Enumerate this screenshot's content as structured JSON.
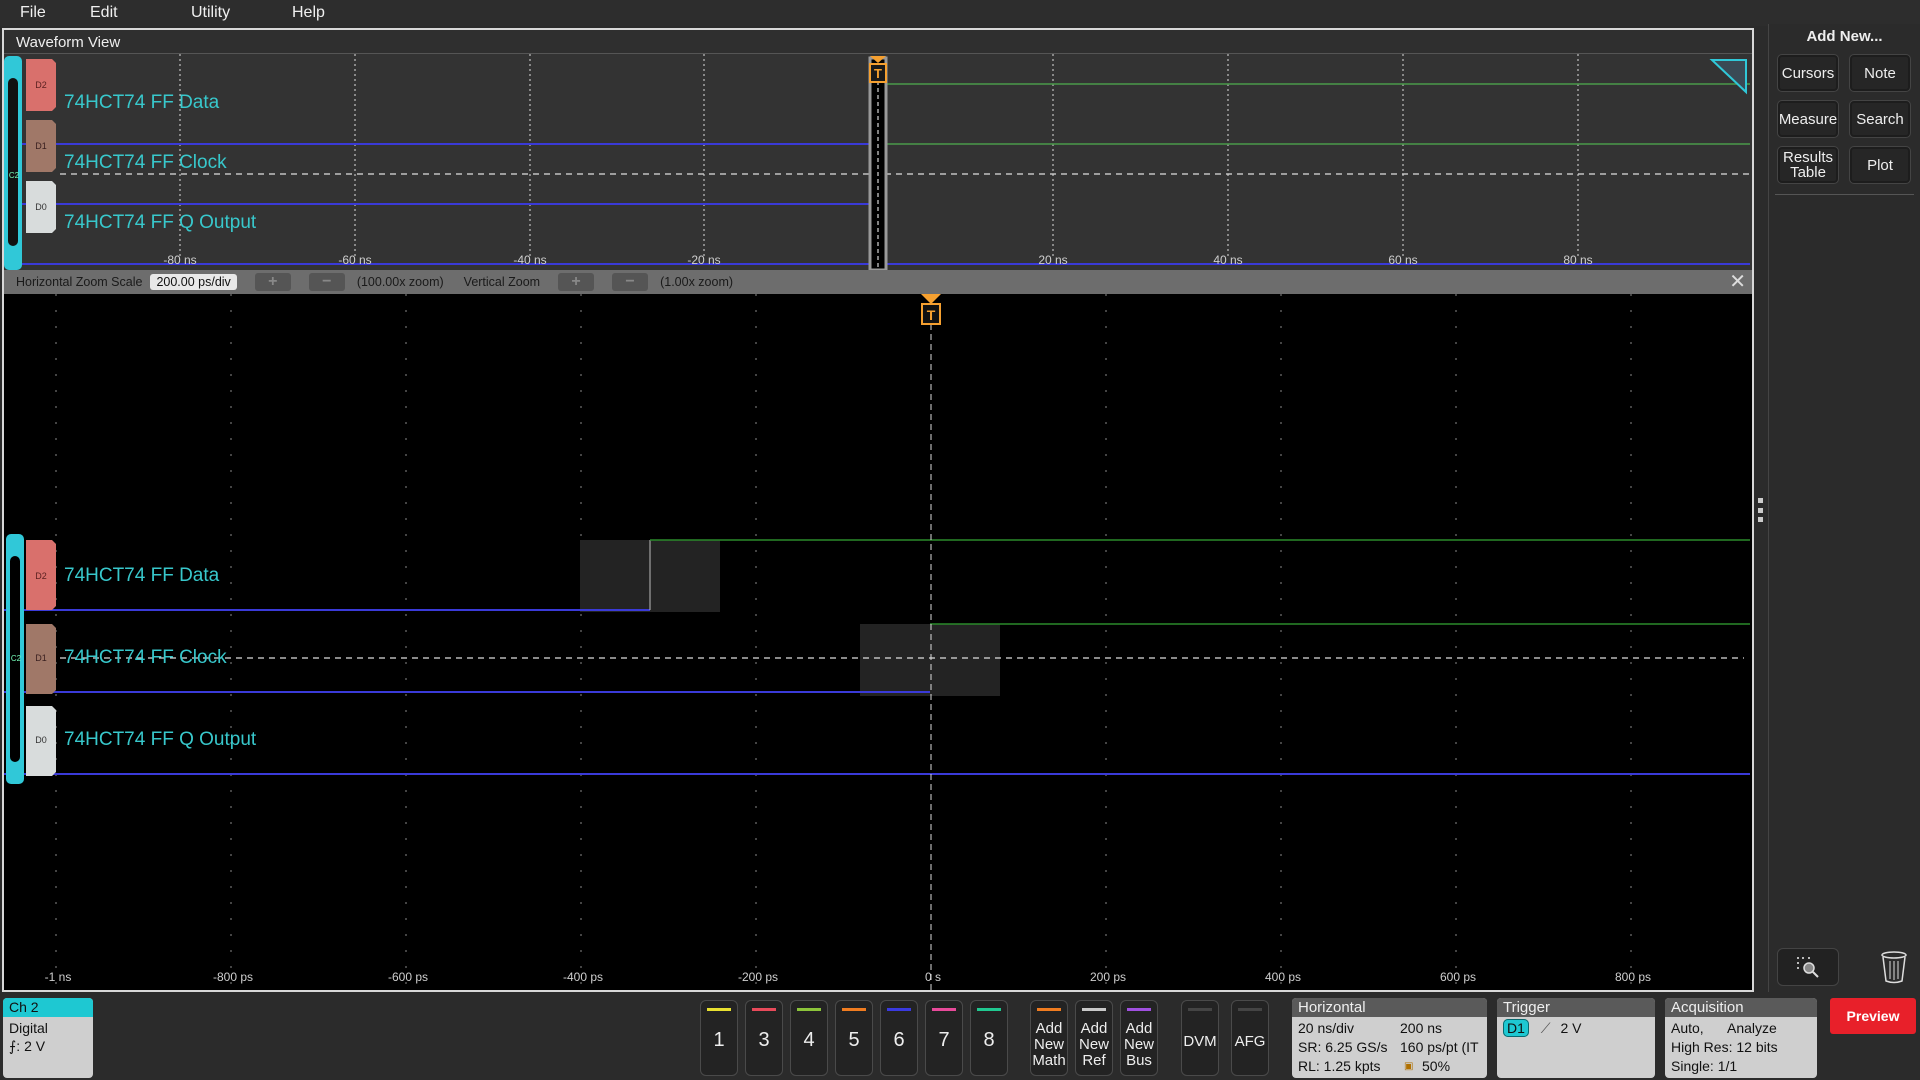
{
  "menu": [
    "File",
    "Edit",
    "Utility",
    "Help"
  ],
  "waveform_view": {
    "title": "Waveform View",
    "overview_axis": [
      "-80 ns",
      "-60 ns",
      "-40 ns",
      "-20 ns",
      "20 ns",
      "40 ns",
      "60 ns",
      "80 ns"
    ],
    "main_axis": [
      "-1 ns",
      "-800 ps",
      "-600 ps",
      "-400 ps",
      "-200 ps",
      "0 s",
      "200 ps",
      "400 ps",
      "600 ps",
      "800 ps"
    ],
    "channels": [
      {
        "tag": "D2",
        "label": "74HCT74 FF Data",
        "color": "#d9706c"
      },
      {
        "tag": "D1",
        "label": "74HCT74 FF Clock",
        "color": "#a07868"
      },
      {
        "tag": "D0",
        "label": "74HCT74 FF Q Output",
        "color": "#d8dcdc"
      }
    ],
    "group_tag": "C2",
    "trigger_marker": "T"
  },
  "zoom_bar": {
    "h_label": "Horizontal Zoom Scale",
    "h_value": "200.00 ps/div",
    "h_zoom": "(100.00x zoom)",
    "v_label": "Vertical Zoom",
    "v_zoom": "(1.00x zoom)",
    "plus": "+",
    "minus": "−",
    "close": "✕"
  },
  "right_panel": {
    "title": "Add New...",
    "buttons": [
      "Cursors",
      "Note",
      "Measure",
      "Search",
      "Results Table",
      "Plot"
    ]
  },
  "bottom": {
    "ch2": {
      "title": "Ch 2",
      "type": "Digital",
      "threshold": "⨍: 2 V"
    },
    "channel_buttons": [
      {
        "label": "1",
        "color": "#e8e030"
      },
      {
        "label": "3",
        "color": "#e84a5a"
      },
      {
        "label": "4",
        "color": "#8cc43a"
      },
      {
        "label": "5",
        "color": "#f07c20"
      },
      {
        "label": "6",
        "color": "#3a3ae0"
      },
      {
        "label": "7",
        "color": "#e84a9a"
      },
      {
        "label": "8",
        "color": "#20c890"
      }
    ],
    "add_buttons": [
      {
        "label": "Add New Math",
        "color": "#f07c20"
      },
      {
        "label": "Add New Ref",
        "color": "#c8c8c8"
      },
      {
        "label": "Add New Bus",
        "color": "#a050e0"
      }
    ],
    "dvm": "DVM",
    "afg": "AFG",
    "horizontal": {
      "title": "Horizontal",
      "scale": "20 ns/div",
      "duration": "200 ns",
      "sr": "SR: 6.25 GS/s",
      "res": "160 ps/pt (IT",
      "rl": "RL: 1.25 kpts",
      "pos": "50%"
    },
    "trigger": {
      "title": "Trigger",
      "source": "D1",
      "level": "2 V"
    },
    "acquisition": {
      "title": "Acquisition",
      "mode": "Auto,",
      "analyze": "Analyze",
      "res": "High Res: 12 bits",
      "single": "Single: 1/1"
    },
    "preview": "Preview"
  }
}
